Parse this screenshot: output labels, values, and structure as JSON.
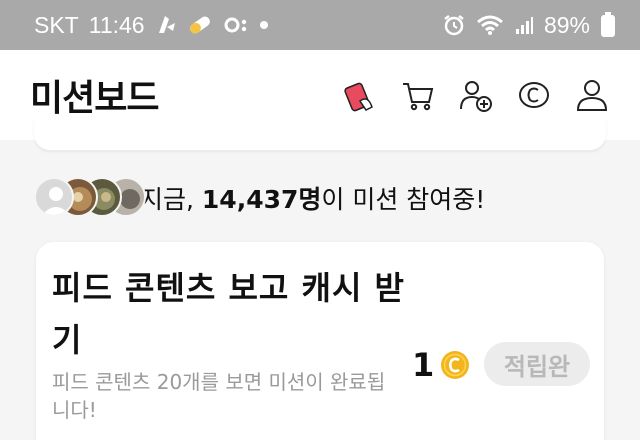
{
  "status_bar": {
    "carrier": "SKT",
    "time": "11:46",
    "battery": "89%",
    "icons": [
      "notification-icon",
      "pill-icon",
      "oo-icon",
      "dot-icon",
      "alarm-icon",
      "wifi-icon",
      "signal-icon",
      "battery-icon"
    ]
  },
  "header": {
    "title": "미션보드",
    "icons": [
      "card-icon",
      "cart-icon",
      "add-friend-icon",
      "cash-icon",
      "profile-icon"
    ]
  },
  "participants": {
    "prefix": "지금, ",
    "count": "14,437명",
    "suffix": "이 미션 참여중!"
  },
  "mission": {
    "title": "피드 콘텐츠 보고 캐시 받기",
    "description": "피드 콘텐츠 20개를 보면 미션이 완료됩니다!",
    "reward": "1",
    "button_label": "적립완"
  },
  "colors": {
    "status_bar": "#a9a9a9",
    "accent_red": "#e84a5f",
    "coin": "#f2b51c",
    "muted": "#9a9a9a"
  }
}
